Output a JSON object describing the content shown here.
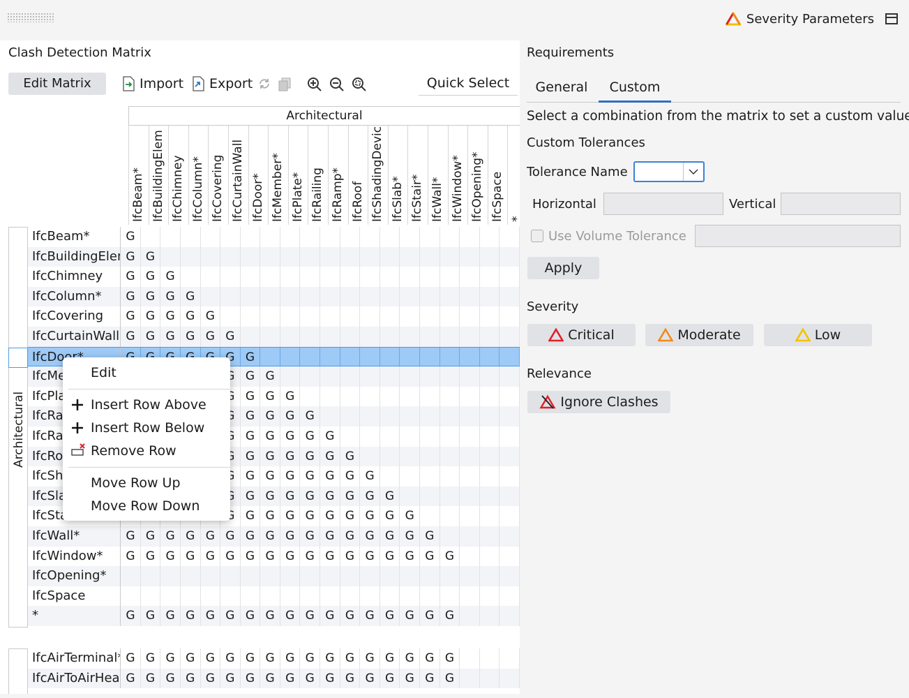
{
  "header": {
    "severity_parameters": "Severity Parameters"
  },
  "left": {
    "title": "Clash Detection Matrix",
    "edit_matrix": "Edit Matrix",
    "import": "Import",
    "export": "Export",
    "quick_select": "Quick Select",
    "group_header": "Architectural",
    "row_group": "Architectural",
    "columns": [
      "IfcBeam*",
      "IfcBuildingElem",
      "IfcChimney",
      "IfcColumn*",
      "IfcCovering",
      "IfcCurtainWall",
      "IfcDoor*",
      "IfcMember*",
      "IfcPlate*",
      "IfcRailing",
      "IfcRamp*",
      "IfcRoof",
      "IfcShadingDevic",
      "IfcSlab*",
      "IfcStair*",
      "IfcWall*",
      "IfcWindow*",
      "IfcOpening*",
      "IfcSpace",
      "* "
    ],
    "rows": [
      {
        "label": "IfcBeam*",
        "n": 1
      },
      {
        "label": "IfcBuildingElem",
        "n": 2
      },
      {
        "label": "IfcChimney",
        "n": 3
      },
      {
        "label": "IfcColumn*",
        "n": 4
      },
      {
        "label": "IfcCovering",
        "n": 5
      },
      {
        "label": "IfcCurtainWall",
        "n": 6
      },
      {
        "label": "IfcDoor*",
        "n": 7
      },
      {
        "label": "IfcMe",
        "n": 8
      },
      {
        "label": "IfcPla",
        "n": 9
      },
      {
        "label": "IfcRa",
        "n": 10
      },
      {
        "label": "IfcRa",
        "n": 11
      },
      {
        "label": "IfcRo",
        "n": 12
      },
      {
        "label": "IfcSh",
        "n": 13
      },
      {
        "label": "IfcSla",
        "n": 14
      },
      {
        "label": "IfcSta",
        "n": 15
      },
      {
        "label": "IfcWall*",
        "n": 16
      },
      {
        "label": "IfcWindow*",
        "n": 17
      },
      {
        "label": "IfcOpening*",
        "n": 0
      },
      {
        "label": "IfcSpace",
        "n": 0
      },
      {
        "label": "*",
        "n": 17
      }
    ],
    "rows2": [
      {
        "label": "IfcAirTerminal*",
        "n": 17
      },
      {
        "label": "IfcAirToAirHeat",
        "n": 17
      }
    ],
    "cell_value": "G"
  },
  "context_menu": {
    "edit": "Edit",
    "insert_above": "Insert Row Above",
    "insert_below": "Insert Row Below",
    "remove_row": "Remove Row",
    "move_up": "Move Row Up",
    "move_down": "Move Row Down"
  },
  "right": {
    "requirements": "Requirements",
    "tab_general": "General",
    "tab_custom": "Custom",
    "instruction": "Select a combination from the matrix to set a custom value",
    "custom_tolerances": "Custom Tolerances",
    "tolerance_name": "Tolerance Name",
    "horizontal": "Horizontal",
    "vertical": "Vertical",
    "use_volume_tolerance": "Use Volume Tolerance",
    "apply": "Apply",
    "severity": "Severity",
    "critical": "Critical",
    "moderate": "Moderate",
    "low": "Low",
    "relevance": "Relevance",
    "ignore_clashes": "Ignore Clashes"
  },
  "colors": {
    "critical": "#e0202a",
    "moderate": "#f08a1c",
    "low": "#f2c200",
    "accent": "#2f6fc2",
    "selection": "#9dcaf6"
  }
}
